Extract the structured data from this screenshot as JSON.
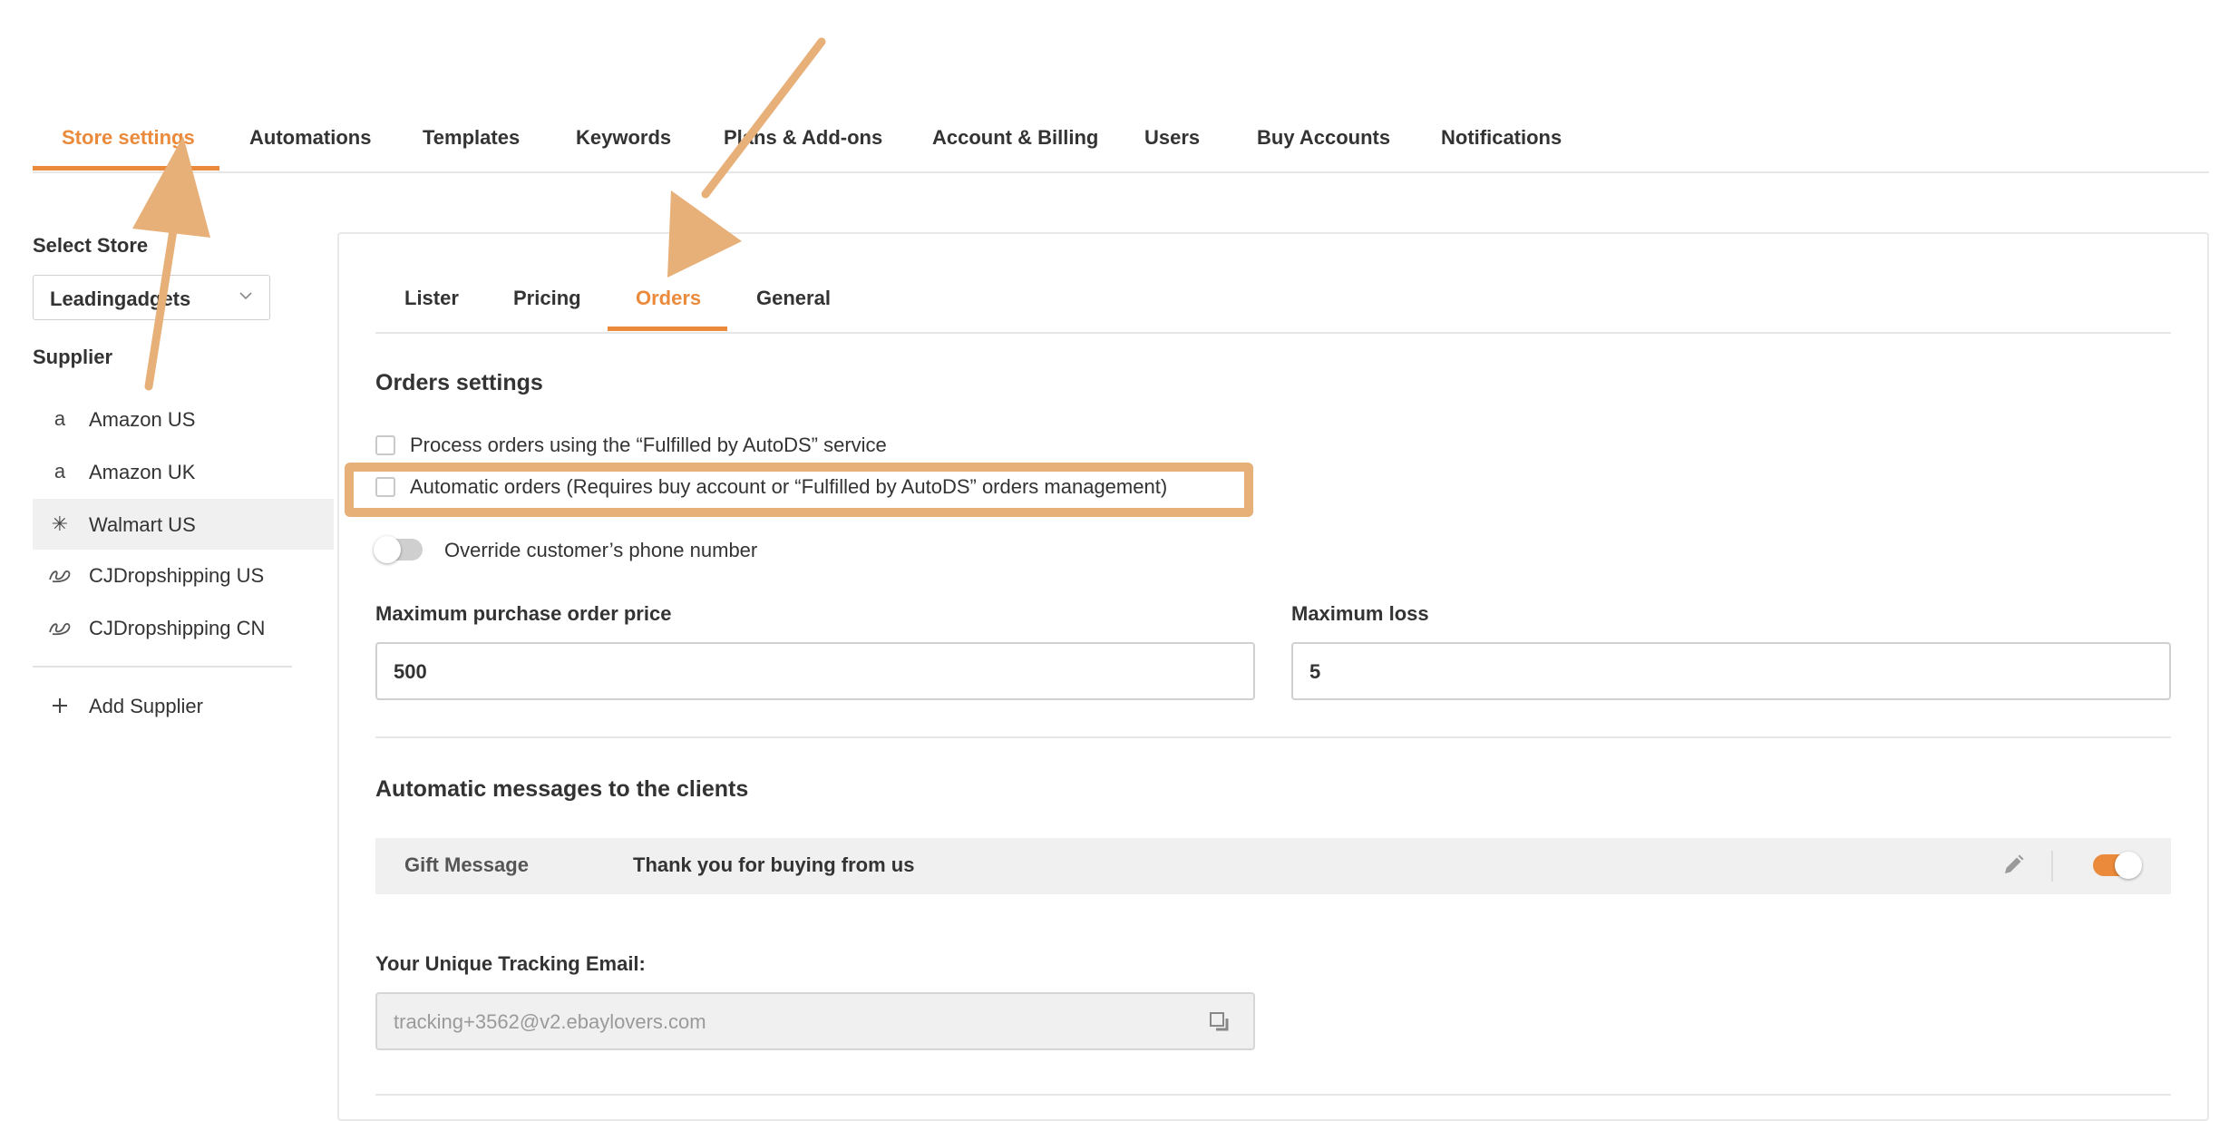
{
  "topnav": {
    "tabs": [
      {
        "label": "Store settings",
        "active": true
      },
      {
        "label": "Automations"
      },
      {
        "label": "Templates"
      },
      {
        "label": "Keywords"
      },
      {
        "label": "Plans & Add-ons"
      },
      {
        "label": "Account & Billing"
      },
      {
        "label": "Users"
      },
      {
        "label": "Buy Accounts"
      },
      {
        "label": "Notifications"
      }
    ]
  },
  "sidebar": {
    "select_store_label": "Select Store",
    "store_value": "Leadingadgets",
    "supplier_label": "Supplier",
    "suppliers": [
      {
        "label": "Amazon US",
        "icon": "amazon-icon"
      },
      {
        "label": "Amazon UK",
        "icon": "amazon-icon"
      },
      {
        "label": "Walmart US",
        "icon": "walmart-icon",
        "active": true
      },
      {
        "label": "CJDropshipping US",
        "icon": "cjdropshipping-icon"
      },
      {
        "label": "CJDropshipping CN",
        "icon": "cjdropshipping-icon"
      }
    ],
    "add_supplier": "Add Supplier"
  },
  "subtabs": [
    {
      "label": "Lister"
    },
    {
      "label": "Pricing"
    },
    {
      "label": "Orders",
      "active": true
    },
    {
      "label": "General"
    }
  ],
  "orders": {
    "title": "Orders settings",
    "fulfilled_checkbox": "Process orders using the “Fulfilled by AutoDS” service",
    "automatic_checkbox": "Automatic orders (Requires buy account or “Fulfilled by AutoDS” orders management)",
    "override_phone": "Override customer’s phone number",
    "max_purchase_label": "Maximum purchase order price",
    "max_purchase_value": "500",
    "max_loss_label": "Maximum loss",
    "max_loss_value": "5"
  },
  "messages": {
    "title": "Automatic messages to the clients",
    "gift_name": "Gift Message",
    "gift_text": "Thank you for buying from us",
    "gift_enabled": true
  },
  "tracking": {
    "label": "Your Unique Tracking Email:",
    "value": "tracking+3562@v2.ebaylovers.com"
  },
  "colors": {
    "accent": "#ea8a3a",
    "annotation": "#e8b079"
  }
}
